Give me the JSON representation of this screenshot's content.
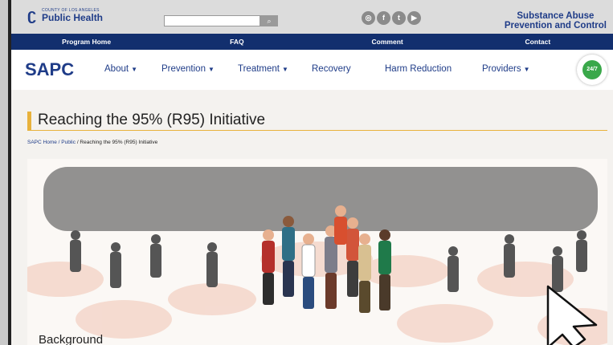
{
  "header": {
    "logo_small": "COUNTY OF LOS ANGELES",
    "logo_big": "Public Health",
    "search_button": "⌕",
    "social_icons": [
      "instagram-icon",
      "facebook-icon",
      "twitter-icon",
      "youtube-icon"
    ],
    "social_glyphs": [
      "◎",
      "f",
      "t",
      "▶"
    ],
    "site_title_line1": "Substance Abuse",
    "site_title_line2": "Prevention and Control"
  },
  "topnav": [
    "Program Home",
    "FAQ",
    "Comment",
    "Contact"
  ],
  "mainnav": {
    "brand": "SAPC",
    "items": [
      "About",
      "Prevention",
      "Treatment",
      "Recovery",
      "Harm Reduction",
      "Providers"
    ],
    "phone_badge": "24/7"
  },
  "page": {
    "title": "Reaching the 95% (R95) Initiative",
    "breadcrumb": [
      "SAPC Home /",
      "Public",
      "/ Reaching the 95% (R95) Initiative"
    ],
    "section_heading": "Background"
  },
  "colors": {
    "brand_blue": "#1f3c88",
    "nav_blue": "#122f6e",
    "accent_gold": "#e8b23c"
  }
}
